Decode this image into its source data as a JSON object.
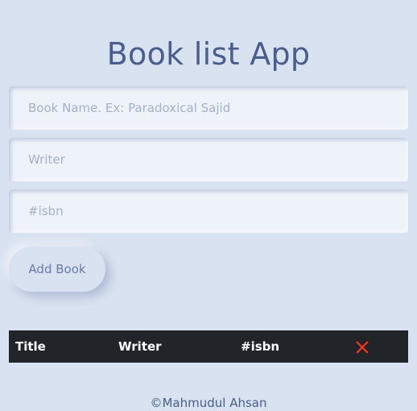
{
  "app": {
    "title": "Book list App"
  },
  "form": {
    "name_placeholder": "Book Name. Ex: Paradoxical Sajid",
    "name_value": "",
    "writer_placeholder": "Writer",
    "writer_value": "",
    "isbn_placeholder": "#isbn",
    "isbn_value": "",
    "submit_label": "Add Book"
  },
  "table": {
    "headers": [
      "Title",
      "Writer",
      "#isbn"
    ],
    "delete_icon": "close-icon",
    "delete_icon_color": "#e0392b",
    "header_bg": "#212529",
    "rows": []
  },
  "footer": {
    "text": "©Mahmudul Ahsan"
  },
  "colors": {
    "background": "#d9e2f0",
    "accent": "#4a5d8c"
  }
}
